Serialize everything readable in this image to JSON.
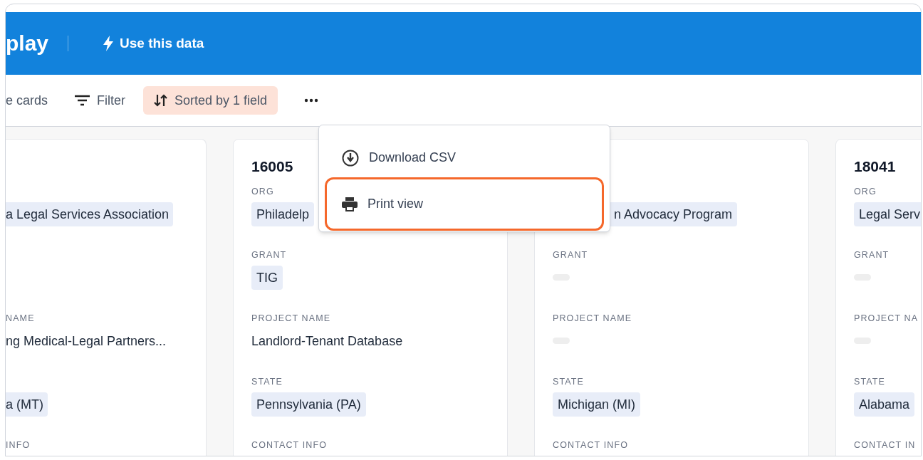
{
  "header": {
    "title": "play",
    "action": "Use this data"
  },
  "toolbar": [
    {
      "kind": "plain",
      "label": "e cards"
    },
    {
      "kind": "filter",
      "label": "Filter"
    },
    {
      "kind": "sort",
      "label": "Sorted by 1 field"
    },
    {
      "kind": "more"
    }
  ],
  "menu": {
    "items": [
      {
        "kind": "download",
        "label": "Download CSV",
        "highlighted": false
      },
      {
        "kind": "print",
        "label": "Print view",
        "highlighted": true
      }
    ]
  },
  "cards": [
    {
      "fields": [
        {
          "kind": "chip",
          "value": "a Legal Services Association"
        },
        {
          "kind": "blank"
        },
        {
          "kind": "text",
          "label": "NAME",
          "value": "ng Medical-Legal Partners..."
        },
        {
          "kind": "chip",
          "value": "a (MT)"
        },
        {
          "kind": "blank",
          "label": "INFO"
        }
      ]
    },
    {
      "number": "16005",
      "fields": [
        {
          "kind": "chip",
          "label": "ORG",
          "value": "Philadelp"
        },
        {
          "kind": "chip",
          "label": "GRANT",
          "value": "TIG"
        },
        {
          "kind": "text",
          "label": "PROJECT NAME",
          "value": "Landlord-Tenant Database"
        },
        {
          "kind": "chip",
          "label": "STATE",
          "value": "Pennsylvania (PA)"
        },
        {
          "kind": "blank",
          "label": "CONTACT INFO"
        }
      ]
    },
    {
      "fields": [
        {
          "kind": "chip",
          "value": "n Advocacy Program",
          "covered": true
        },
        {
          "kind": "empty",
          "label": "GRANT"
        },
        {
          "kind": "empty",
          "label": "PROJECT NAME"
        },
        {
          "kind": "chip",
          "label": "STATE",
          "value": "Michigan (MI)"
        },
        {
          "kind": "blank",
          "label": "CONTACT INFO"
        }
      ]
    },
    {
      "number": "18041",
      "fields": [
        {
          "kind": "chip",
          "label": "ORG",
          "value": "Legal Serv"
        },
        {
          "kind": "empty",
          "label": "GRANT"
        },
        {
          "kind": "empty",
          "label": "PROJECT NA"
        },
        {
          "kind": "chip",
          "label": "STATE",
          "value": "Alabama"
        },
        {
          "kind": "blank",
          "label": "CONTACT IN"
        }
      ]
    }
  ]
}
